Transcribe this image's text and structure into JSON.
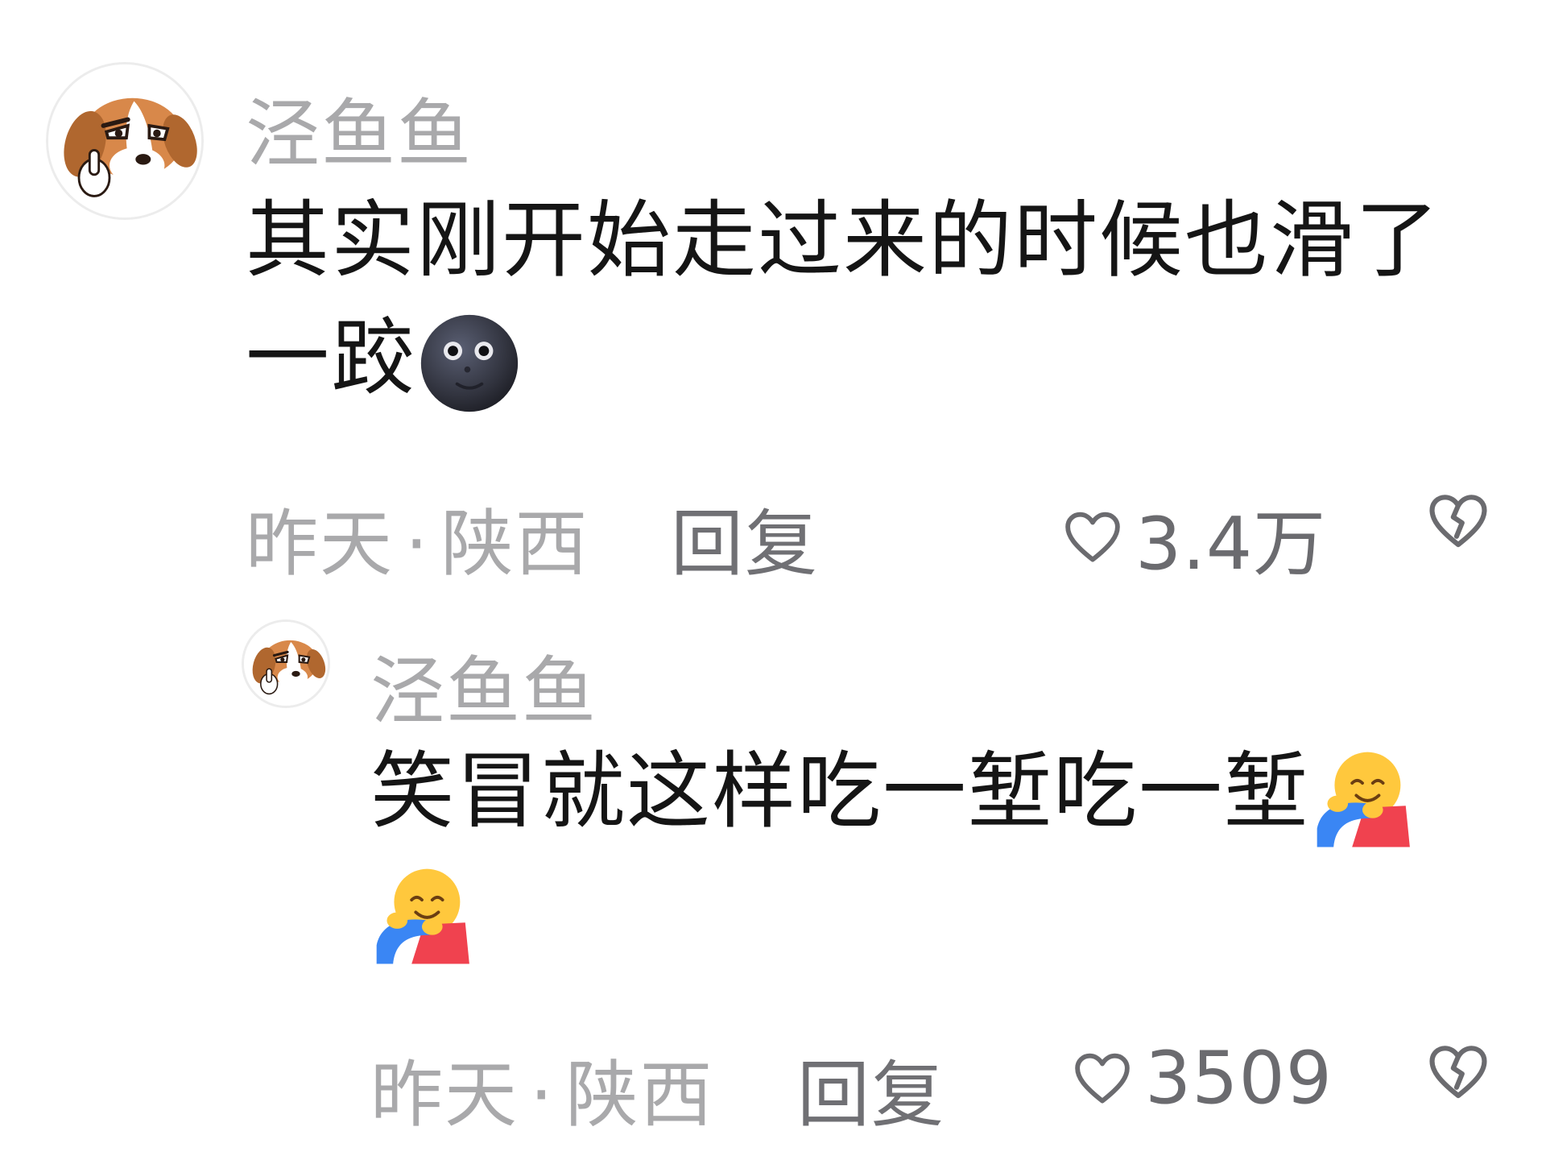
{
  "comments": [
    {
      "username": "泾鱼鱼",
      "avatar_icon": "beagle-dog-avatar-icon",
      "text": "其实刚开始走过来的时候也滑了一跤",
      "emojis": [
        "new-moon-face-emoji"
      ],
      "time": "昨天",
      "location": "陕西",
      "reply_label": "回复",
      "likes": "3.4万"
    },
    {
      "username": "泾鱼鱼",
      "avatar_icon": "beagle-dog-avatar-icon",
      "text": "笑冒就这样吃一堑吃一堑",
      "emojis": [
        "hugging-face-emoji",
        "hugging-face-emoji"
      ],
      "time": "昨天",
      "location": "陕西",
      "reply_label": "回复",
      "likes": "3509"
    }
  ],
  "meta_separator": "·",
  "colors": {
    "background": "#ffffff",
    "username": "#a9a9ab",
    "body_text": "#151515",
    "meta_text": "#a9a9ab",
    "action_text": "#707074"
  }
}
